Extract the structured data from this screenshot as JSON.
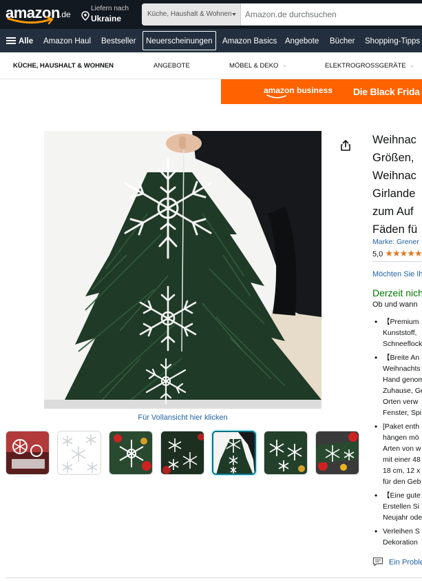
{
  "header": {
    "logo_text": "amazon",
    "logo_tld": ".de",
    "deliver_line1": "Liefern nach",
    "deliver_line2": "Ukraine",
    "search_category": "Küche, Haushalt & Wohnen",
    "search_placeholder": "Amazon.de durchsuchen"
  },
  "nav": {
    "all_label": "Alle",
    "items": [
      "Amazon Haul",
      "Bestseller",
      "Neuerscheinungen",
      "Amazon Basics",
      "Angebote",
      "Bücher",
      "Shopping-Tipps"
    ],
    "active_index": 2
  },
  "subnav": {
    "items": [
      "KÜCHE, HAUSHALT & WOHNEN",
      "ANGEBOTE",
      "MÖBEL & DEKO",
      "ELEKTROGROSSGERÄTE"
    ]
  },
  "banner": {
    "brand": "amazon business",
    "slogan": "Die Black Frida"
  },
  "gallery": {
    "fullview_link": "Für Vollansicht hier klicken",
    "thumb_count": 7,
    "active_thumb": 4
  },
  "product": {
    "title_lines": [
      "Weihnac",
      "Größen,",
      "Weihnac",
      "Girlande",
      "zum Auf",
      "Fäden fü"
    ],
    "brand": "Marke: Grener",
    "rating_value": "5,0",
    "rating_stars": "★★★★★",
    "question": "Möchten Sie Ih",
    "availability": "Derzeit nich",
    "availability_sub": "Ob und wann",
    "bullets": [
      [
        "【Premium",
        "Kunststoff,",
        "Schneeflock"
      ],
      [
        "【Breite An",
        "Weihnachts",
        "Hand genom",
        "Zuhause, Ge",
        "Orten verw",
        "Fenster, Spi"
      ],
      [
        "[Paket enth",
        "hängen mö",
        "Arten von w",
        "mit einer 48",
        "18 cm, 12 x",
        "für den Geb"
      ],
      [
        "【Eine gute",
        "Erstellen Si",
        "Neujahr ode"
      ],
      [
        "Verleihen S",
        "Dekoration"
      ]
    ],
    "report_link": "Ein Proble"
  },
  "colors": {
    "header_bg": "#131921",
    "nav_bg": "#232f3e",
    "banner_bg": "#ff6200",
    "link": "#2162a1",
    "in_stock_green": "#007600",
    "star": "#de7921"
  }
}
